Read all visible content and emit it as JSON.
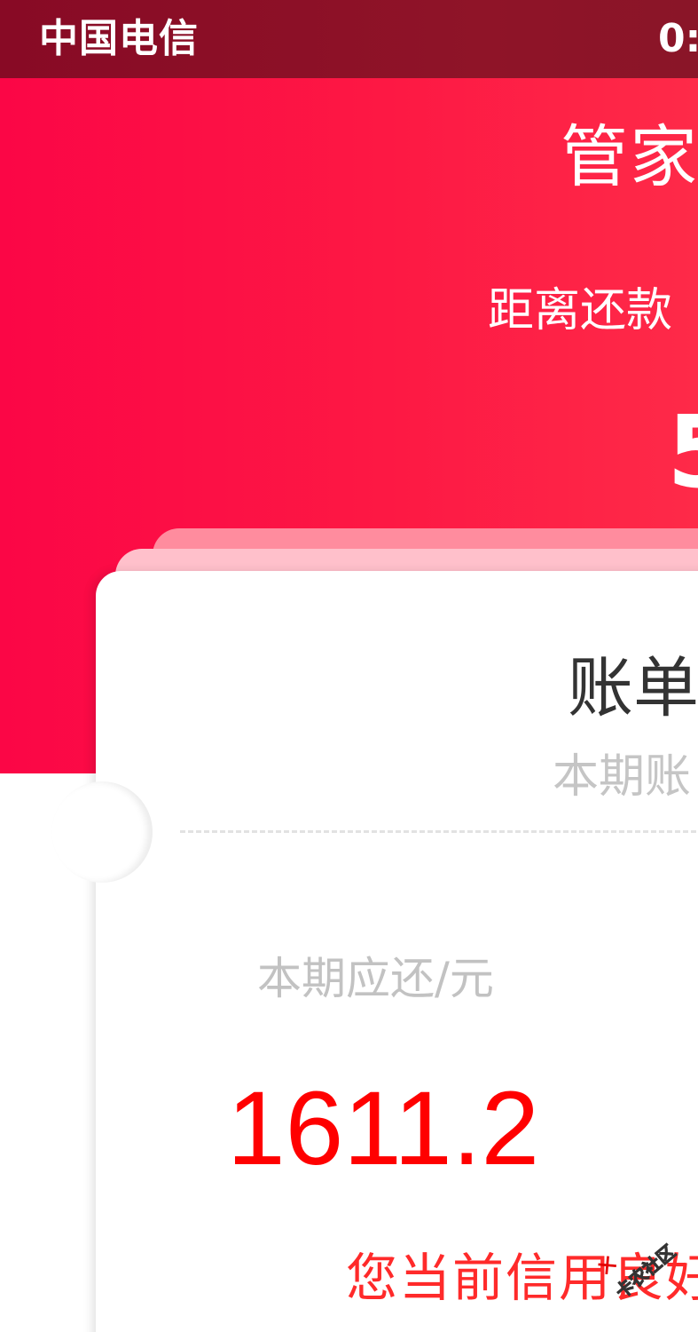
{
  "status_bar": {
    "carrier": "中国电信",
    "time": "0:"
  },
  "hero": {
    "title": "管家",
    "countdown_label": "距离还款",
    "countdown_value": "5"
  },
  "card": {
    "title": "账单",
    "subtitle": "本期账",
    "due_label": "本期应还/元",
    "due_amount": "1611.2",
    "credit_message": "您当前信用良好"
  },
  "watermark": {
    "text": "卡农社区"
  },
  "colors": {
    "status_bar": "#880a25",
    "hero_start": "#fb0646",
    "hero_end": "#fe2a48",
    "amount": "#ff0000",
    "credit_message": "#ff2a2a",
    "muted_text": "#c5c5c5"
  }
}
